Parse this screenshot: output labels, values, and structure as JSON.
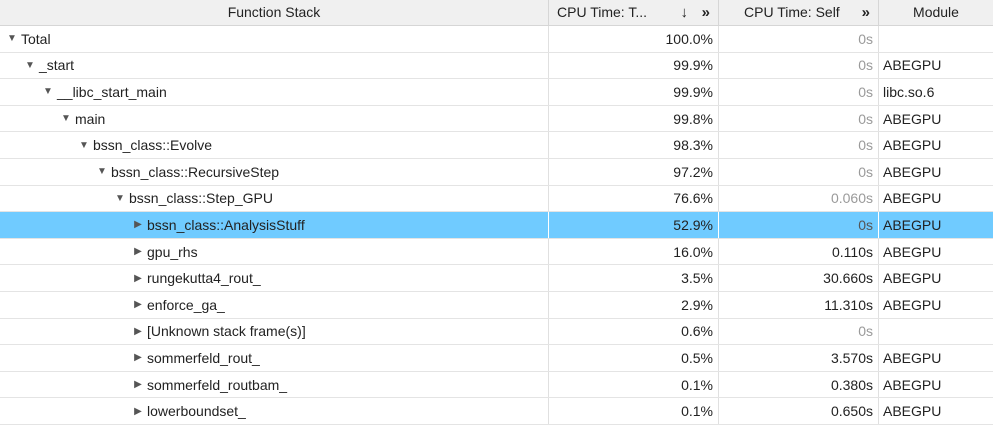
{
  "columns": {
    "function_stack": "Function Stack",
    "cpu_total": "CPU Time: T...",
    "cpu_self": "CPU Time: Self",
    "module": "Module",
    "sort_glyph": "↓",
    "expand_glyph": "»"
  },
  "rows": [
    {
      "name": "Total",
      "level": 0,
      "expanded": true,
      "total": "100.0%",
      "self": "0s",
      "module": ""
    },
    {
      "name": "_start",
      "level": 1,
      "expanded": true,
      "total": "99.9%",
      "self": "0s",
      "module": "ABEGPU"
    },
    {
      "name": "__libc_start_main",
      "level": 2,
      "expanded": true,
      "total": "99.9%",
      "self": "0s",
      "module": "libc.so.6"
    },
    {
      "name": "main",
      "level": 3,
      "expanded": true,
      "total": "99.8%",
      "self": "0s",
      "module": "ABEGPU"
    },
    {
      "name": "bssn_class::Evolve",
      "level": 4,
      "expanded": true,
      "total": "98.3%",
      "self": "0s",
      "module": "ABEGPU"
    },
    {
      "name": "bssn_class::RecursiveStep",
      "level": 5,
      "expanded": true,
      "total": "97.2%",
      "self": "0s",
      "module": "ABEGPU"
    },
    {
      "name": "bssn_class::Step_GPU",
      "level": 6,
      "expanded": true,
      "total": "76.6%",
      "self": "0.060s",
      "module": "ABEGPU"
    },
    {
      "name": "bssn_class::AnalysisStuff",
      "level": 7,
      "expanded": false,
      "total": "52.9%",
      "self": "0s",
      "module": "ABEGPU",
      "selected": true
    },
    {
      "name": "gpu_rhs",
      "level": 7,
      "expanded": false,
      "total": "16.0%",
      "self": "0.110s",
      "module": "ABEGPU"
    },
    {
      "name": "rungekutta4_rout_",
      "level": 7,
      "expanded": false,
      "total": "3.5%",
      "self": "30.660s",
      "module": "ABEGPU"
    },
    {
      "name": "enforce_ga_",
      "level": 7,
      "expanded": false,
      "total": "2.9%",
      "self": "11.310s",
      "module": "ABEGPU"
    },
    {
      "name": "[Unknown stack frame(s)]",
      "level": 7,
      "expanded": false,
      "total": "0.6%",
      "self": "0s",
      "module": ""
    },
    {
      "name": "sommerfeld_rout_",
      "level": 7,
      "expanded": false,
      "total": "0.5%",
      "self": "3.570s",
      "module": "ABEGPU"
    },
    {
      "name": "sommerfeld_routbam_",
      "level": 7,
      "expanded": false,
      "total": "0.1%",
      "self": "0.380s",
      "module": "ABEGPU"
    },
    {
      "name": "lowerboundset_",
      "level": 7,
      "expanded": false,
      "total": "0.1%",
      "self": "0.650s",
      "module": "ABEGPU"
    }
  ]
}
